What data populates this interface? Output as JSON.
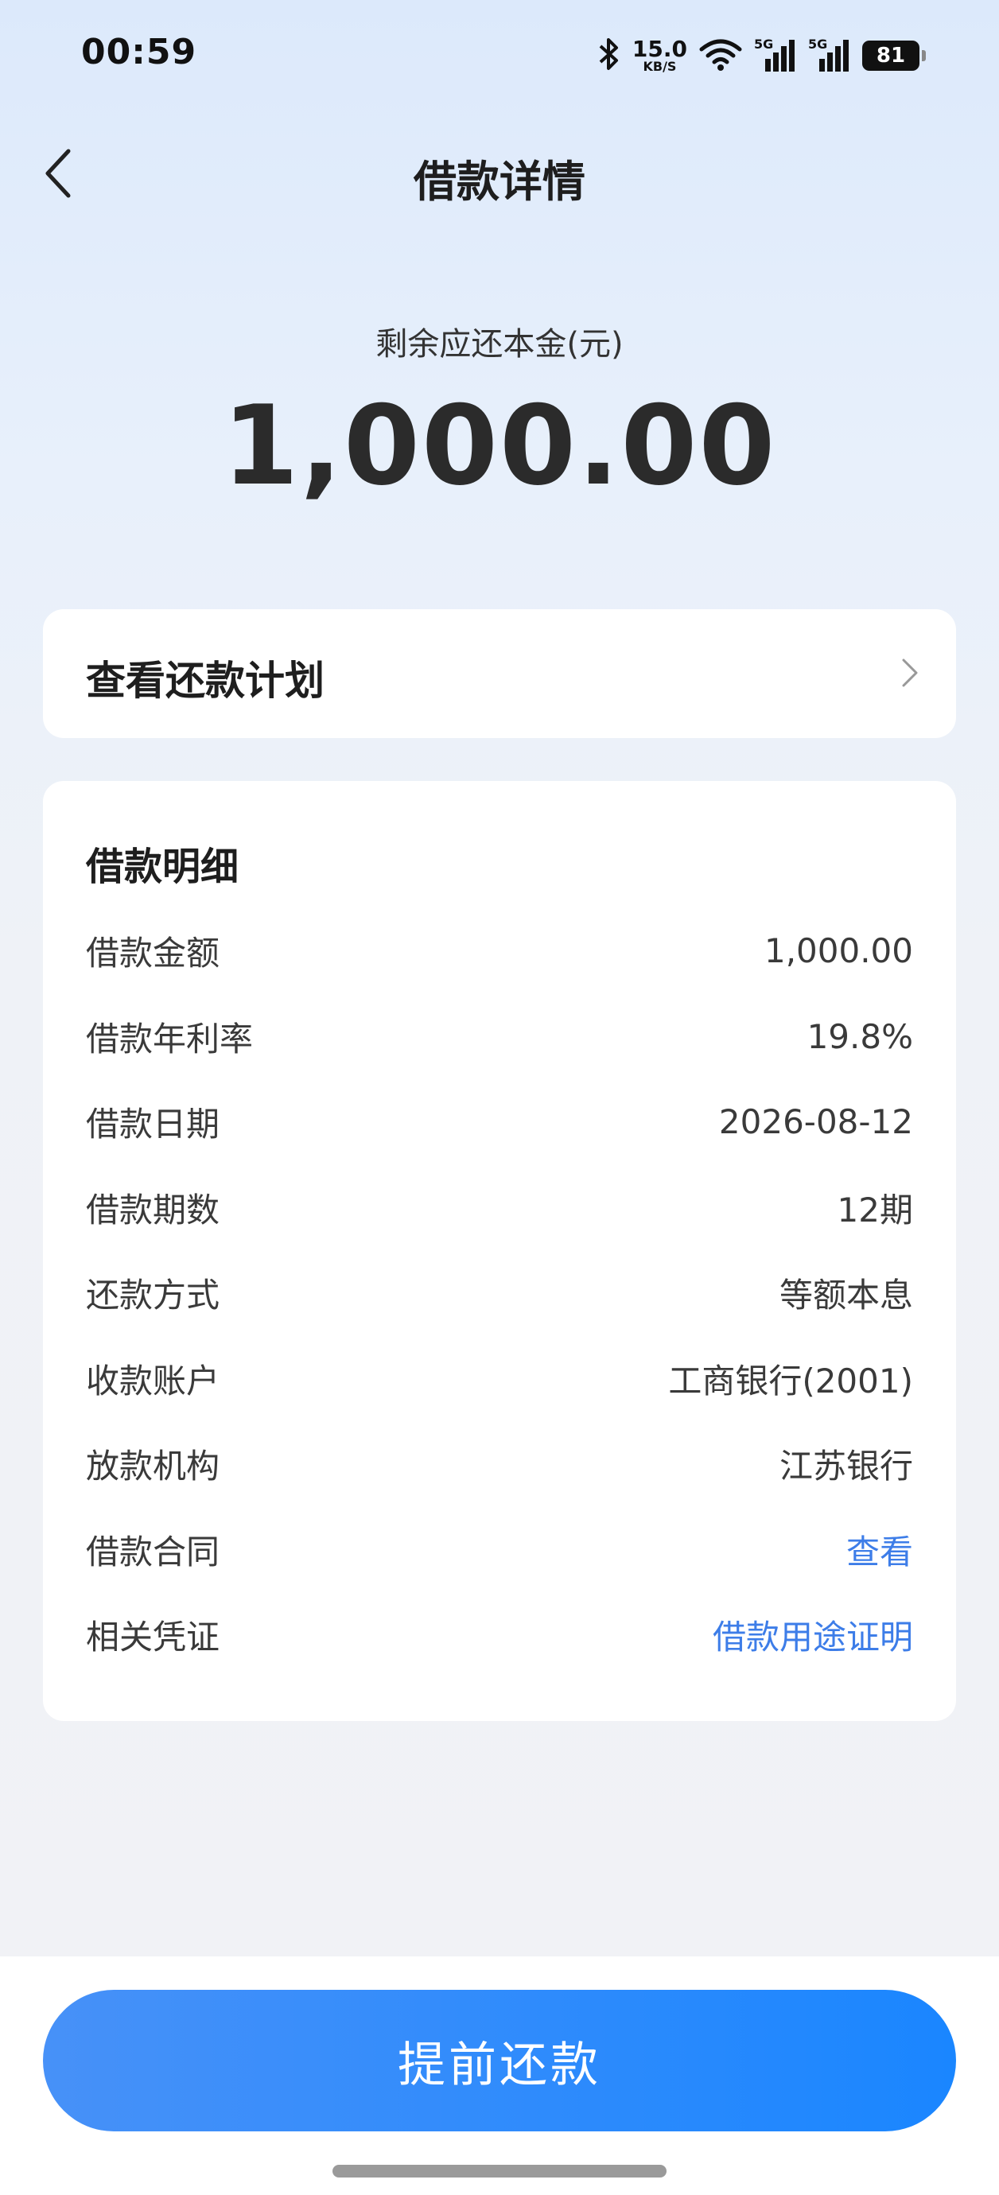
{
  "status_bar": {
    "time": "00:59",
    "net_speed_value": "15.0",
    "net_speed_unit": "KB/S",
    "network_1": "5G",
    "network_2": "5G",
    "battery": "81"
  },
  "header": {
    "title": "借款详情",
    "back_icon": "chevron-left-icon"
  },
  "summary": {
    "label": "剩余应还本金(元)",
    "amount": "1,000.00"
  },
  "repayment_plan": {
    "label": "查看还款计划",
    "icon": "chevron-right-icon"
  },
  "details": {
    "title": "借款明细",
    "rows": [
      {
        "label": "借款金额",
        "value": "1,000.00"
      },
      {
        "label": "借款年利率",
        "value": "19.8%"
      },
      {
        "label": "借款日期",
        "value": "2026-08-12"
      },
      {
        "label": "借款期数",
        "value": "12期"
      },
      {
        "label": "还款方式",
        "value": "等额本息"
      },
      {
        "label": "收款账户",
        "value": "工商银行(2001)"
      },
      {
        "label": "放款机构",
        "value": "江苏银行"
      },
      {
        "label": "借款合同",
        "value": "查看"
      },
      {
        "label": "相关凭证",
        "value": "借款用途证明"
      }
    ]
  },
  "footer": {
    "prepay_label": "提前还款"
  },
  "colors": {
    "accent": "#1a86ff",
    "link": "#3d7de8",
    "background_top": "#dce9fb"
  }
}
